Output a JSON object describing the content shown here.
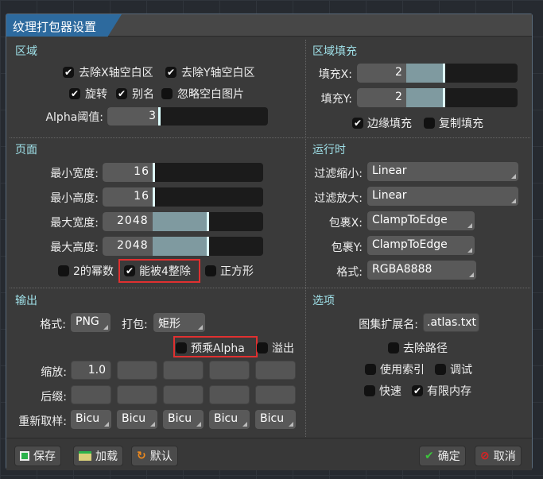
{
  "window": {
    "title": "纹理打包器设置"
  },
  "region": {
    "title": "区域",
    "strip_x": "去除X轴空白区",
    "strip_y": "去除Y轴空白区",
    "rotation": "旋转",
    "alias": "别名",
    "ignore_blank": "忽略空白图片",
    "alpha_label": "Alpha阈值:",
    "alpha_value": "3",
    "checked": {
      "strip_x": true,
      "strip_y": true,
      "rotation": true,
      "alias": true,
      "ignore_blank": false
    }
  },
  "page": {
    "title": "页面",
    "min_width_label": "最小宽度:",
    "min_width": "16",
    "min_height_label": "最小高度:",
    "min_height": "16",
    "max_width_label": "最大宽度:",
    "max_width": "2048",
    "max_height_label": "最大高度:",
    "max_height": "2048",
    "pot": "2的幂数",
    "multiple_of_four": "能被4整除",
    "square": "正方形",
    "checked": {
      "pot": false,
      "multiple_of_four": true,
      "square": false
    }
  },
  "output": {
    "title": "输出",
    "format_label": "格式:",
    "format": "PNG",
    "pack_label": "打包:",
    "pack": "矩形",
    "premultiply": "预乘Alpha",
    "bleed": "溢出",
    "scale_label": "缩放:",
    "scales": [
      "1.0",
      "",
      "",
      "",
      ""
    ],
    "suffix_label": "后缀:",
    "suffixes": [
      "",
      "",
      "",
      "",
      ""
    ],
    "resample_label": "重新取样:",
    "resamples": [
      "Bicu",
      "Bicu",
      "Bicu",
      "Bicu",
      "Bicu"
    ]
  },
  "fill": {
    "title": "区域填充",
    "pad_x_label": "填充X:",
    "pad_x": "2",
    "pad_y_label": "填充Y:",
    "pad_y": "2",
    "edge_padding": "边缘填充",
    "duplicate_padding": "复制填充",
    "checked": {
      "edge_padding": true,
      "duplicate_padding": false
    }
  },
  "runtime": {
    "title": "运行时",
    "filter_min_label": "过滤缩小:",
    "filter_min": "Linear",
    "filter_mag_label": "过滤放大:",
    "filter_mag": "Linear",
    "wrap_x_label": "包裹X:",
    "wrap_x": "ClampToEdge",
    "wrap_y_label": "包裹Y:",
    "wrap_y": "ClampToEdge",
    "format_label": "格式:",
    "format": "RGBA8888"
  },
  "options": {
    "title": "选项",
    "atlas_ext_label": "图集扩展名:",
    "atlas_ext": ".atlas.txt",
    "strip_paths": "去除路径",
    "use_indexes": "使用索引",
    "debug": "调试",
    "fast": "快速",
    "limit_memory": "有限内存",
    "checked": {
      "strip_paths": false,
      "use_indexes": false,
      "debug": false,
      "fast": false,
      "limit_memory": true
    }
  },
  "buttons": {
    "save": "保存",
    "load": "加载",
    "defaults": "默认",
    "ok": "确定",
    "cancel": "取消"
  },
  "colors": {
    "title_tab": "#2d6a9e",
    "section_title": "#9fe0e8",
    "highlight_box": "#e03030"
  }
}
